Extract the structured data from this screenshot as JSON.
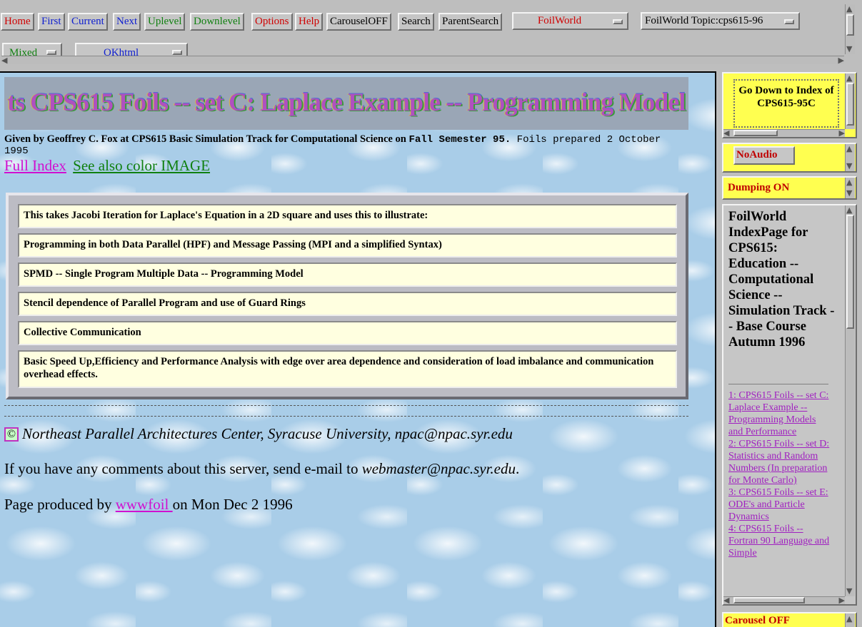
{
  "toolbar": {
    "buttons": [
      {
        "label": "Home",
        "color": "#d00000"
      },
      {
        "label": "First",
        "color": "#1020d0"
      },
      {
        "label": "Current",
        "color": "#1020d0"
      },
      {
        "label": "Next",
        "color": "#1020d0"
      },
      {
        "label": "Uplevel",
        "color": "#108010"
      },
      {
        "label": "Downlevel",
        "color": "#108010"
      },
      {
        "label": "Options",
        "color": "#d00000"
      },
      {
        "label": "Help",
        "color": "#d00000"
      },
      {
        "label": "CarouselOFF",
        "color": "#000000"
      },
      {
        "label": "Search",
        "color": "#000000"
      },
      {
        "label": "ParentSearch",
        "color": "#000000"
      }
    ],
    "foilworld_select": "FoilWorld",
    "topic_select": "FoilWorld Topic:cps615-96",
    "mixed_select": "Mixed",
    "okhtml_select": "OKhtml"
  },
  "main": {
    "banner_text": "ts CPS615 Foils -- set C: Laplace Example -- Programming Model",
    "byline": {
      "given_by": "Given by Geoffrey C. Fox at CPS615 Basic Simulation Track for Computational Science on ",
      "semester": "Fall Semester 95.",
      "prepared": " Foils prepared 2 October 1995"
    },
    "full_index_link": "Full Index",
    "color_image_link": "See also color IMAGE",
    "bullets": [
      "This takes Jacobi Iteration for Laplace's Equation in a 2D square and uses this to illustrate:",
      "Programming in both Data Parallel (HPF) and Message Passing (MPI and a simplified Syntax)",
      "SPMD -- Single Program Multiple Data -- Programming Model",
      "Stencil dependence of Parallel Program and use of Guard Rings",
      "Collective Communication",
      "Basic Speed Up,Efficiency and Performance Analysis with edge over area dependence and consideration of load imbalance and communication overhead effects."
    ],
    "copyright_symbol": "©",
    "npac_text": "Northeast Parallel Architectures Center, Syracuse University, npac@npac.syr.edu",
    "comments_prefix": "If you have any comments about this server, send e-mail to ",
    "webmaster_email": "webmaster@npac.syr.edu",
    "comments_suffix": ".",
    "produced_prefix": "Page produced by ",
    "produced_link": "wwwfoil ",
    "produced_suffix": "on Mon Dec 2 1996"
  },
  "sidebar": {
    "go_down_link": "Go Down to Index of CPS615-95C",
    "noaudio_button": "NoAudio",
    "dumping_text": "Dumping ON",
    "index_title": "FoilWorld IndexPage for CPS615: Education -- Computational Science -- Simulation Track -- Base Course Autumn 1996",
    "index_items": [
      "1: CPS615 Foils -- set C: Laplace Example -- Programming Models and Performance",
      "2: CPS615 Foils -- set D: Statistics and Random Numbers (In preparation for Monte Carlo)",
      "3: CPS615 Foils -- set E: ODE's and Particle Dynamics",
      "4: CPS615 Foils -- Fortran 90 Language and Simple"
    ],
    "carousel_text": "Carousel OFF"
  },
  "colors": {
    "link_magenta": "#d010d0",
    "link_green": "#108010",
    "panel_yellow": "#ffff50",
    "row_bg": "#ffffe0",
    "sky": "#a9cde8"
  }
}
